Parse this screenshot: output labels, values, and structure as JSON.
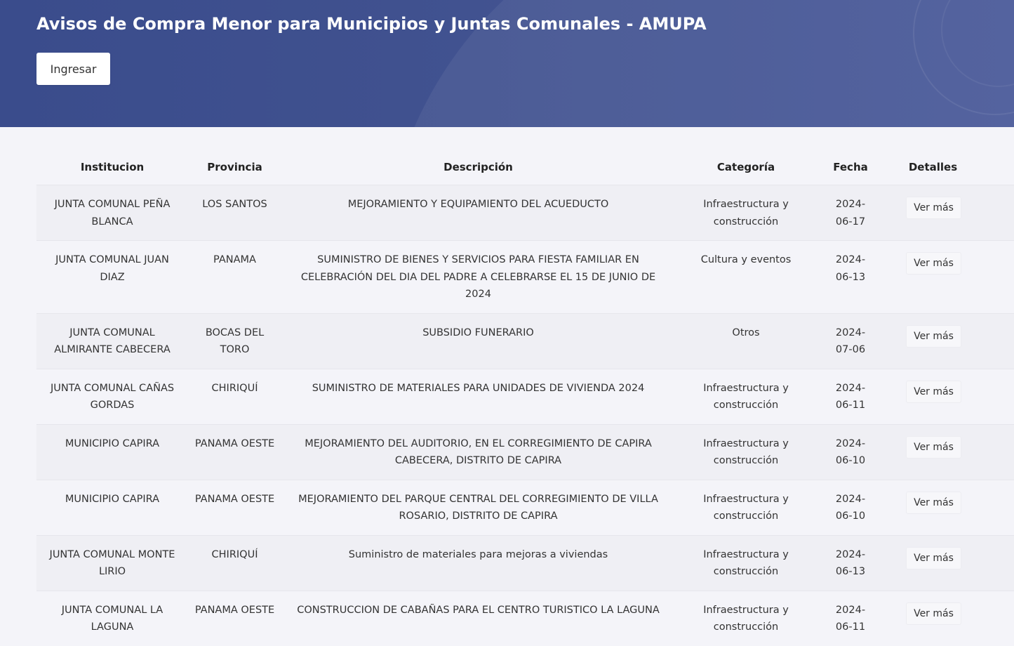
{
  "header": {
    "title": "Avisos de Compra Menor para Municipios y Juntas Comunales - AMUPA",
    "login_label": "Ingresar"
  },
  "table": {
    "columns": [
      "Institucion",
      "Provincia",
      "Descripción",
      "Categoría",
      "Fecha",
      "Detalles"
    ],
    "rows": [
      {
        "institucion": "JUNTA COMUNAL PEÑA BLANCA",
        "provincia": "LOS SANTOS",
        "descripcion": "MEJORAMIENTO Y EQUIPAMIENTO DEL ACUEDUCTO",
        "categoria": "Infraestructura y construcción",
        "fecha": "2024-06-17",
        "detalles": "Ver más"
      },
      {
        "institucion": "JUNTA COMUNAL JUAN DIAZ",
        "provincia": "PANAMA",
        "descripcion": "SUMINISTRO DE BIENES Y SERVICIOS PARA FIESTA FAMILIAR EN CELEBRACIÓN DEL DIA DEL PADRE A CELEBRARSE EL 15 DE JUNIO DE 2024",
        "categoria": "Cultura y eventos",
        "fecha": "2024-06-13",
        "detalles": "Ver más"
      },
      {
        "institucion": "JUNTA COMUNAL ALMIRANTE CABECERA",
        "provincia": "BOCAS DEL TORO",
        "descripcion": "SUBSIDIO FUNERARIO",
        "categoria": "Otros",
        "fecha": "2024-07-06",
        "detalles": "Ver más"
      },
      {
        "institucion": "JUNTA COMUNAL CAÑAS GORDAS",
        "provincia": "CHIRIQUÍ",
        "descripcion": "SUMINISTRO DE MATERIALES PARA UNIDADES DE VIVIENDA 2024",
        "categoria": "Infraestructura y construcción",
        "fecha": "2024-06-11",
        "detalles": "Ver más"
      },
      {
        "institucion": "MUNICIPIO CAPIRA",
        "provincia": "PANAMA OESTE",
        "descripcion": "MEJORAMIENTO DEL AUDITORIO, EN EL CORREGIMIENTO DE CAPIRA CABECERA, DISTRITO DE CAPIRA",
        "categoria": "Infraestructura y construcción",
        "fecha": "2024-06-10",
        "detalles": "Ver más"
      },
      {
        "institucion": "MUNICIPIO CAPIRA",
        "provincia": "PANAMA OESTE",
        "descripcion": "MEJORAMIENTO DEL PARQUE CENTRAL DEL CORREGIMIENTO DE VILLA ROSARIO, DISTRITO DE CAPIRA",
        "categoria": "Infraestructura y construcción",
        "fecha": "2024-06-10",
        "detalles": "Ver más"
      },
      {
        "institucion": "JUNTA COMUNAL MONTE LIRIO",
        "provincia": "CHIRIQUÍ",
        "descripcion": "Suministro de materiales para mejoras a viviendas",
        "categoria": "Infraestructura y construcción",
        "fecha": "2024-06-13",
        "detalles": "Ver más"
      },
      {
        "institucion": "JUNTA COMUNAL LA LAGUNA",
        "provincia": "PANAMA OESTE",
        "descripcion": "CONSTRUCCION DE CABAÑAS PARA EL CENTRO TURISTICO LA LAGUNA",
        "categoria": "Infraestructura y construcción",
        "fecha": "2024-06-11",
        "detalles": "Ver más"
      }
    ]
  }
}
